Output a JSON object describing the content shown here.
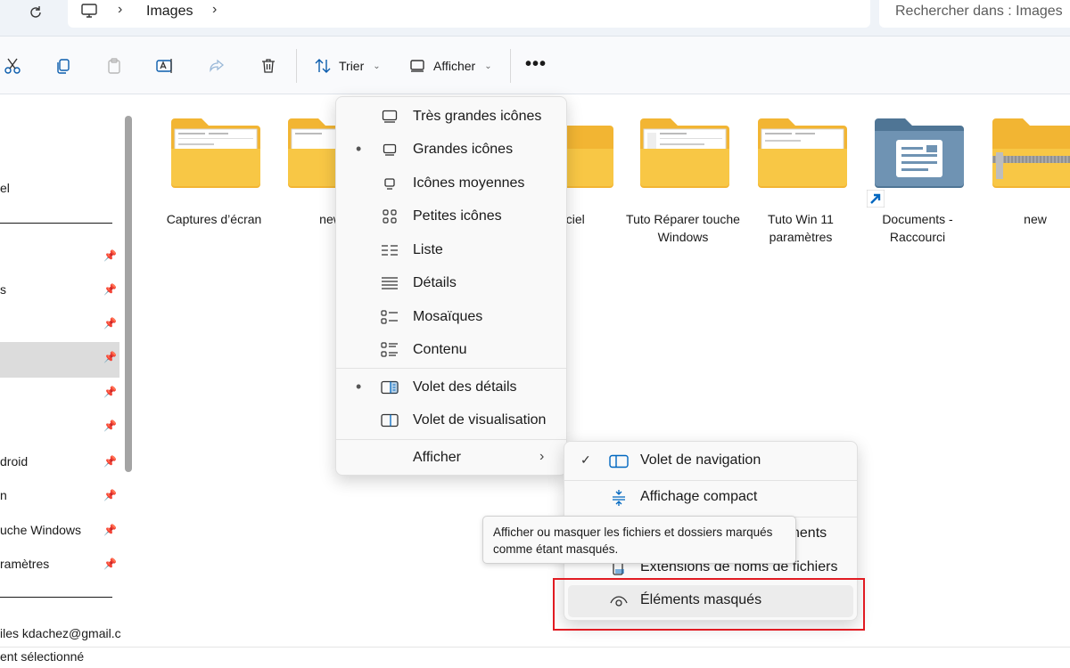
{
  "address_bar": {
    "breadcrumb": [
      "Images"
    ],
    "search_placeholder": "Rechercher dans : Images"
  },
  "command_bar": {
    "buttons": [
      "cut-icon",
      "copy-icon",
      "paste-icon",
      "rename-icon",
      "share-icon",
      "delete-icon"
    ],
    "sort_label": "Trier",
    "view_label": "Afficher",
    "more_label": "•••"
  },
  "sidebar": {
    "items": [
      {
        "label": "el"
      },
      {
        "label": ""
      },
      {
        "label": "s"
      },
      {
        "label": ""
      },
      {
        "label": ""
      },
      {
        "label": ""
      },
      {
        "label": ""
      },
      {
        "label": "droid"
      },
      {
        "label": "n"
      },
      {
        "label": "uche Windows"
      },
      {
        "label": "ramètres"
      }
    ],
    "account": "iles   kdachez@gmail.c"
  },
  "status_bar": {
    "text": "ent sélectionné"
  },
  "folders": [
    {
      "name": "Captures d’écran",
      "type": "folder-preview"
    },
    {
      "name": "new",
      "type": "folder"
    },
    {
      "name": "officiel",
      "type": "folder"
    },
    {
      "name": "Tuto Réparer touche Windows",
      "type": "folder-preview"
    },
    {
      "name": "Tuto Win 11 paramètres",
      "type": "folder-preview"
    },
    {
      "name": "Documents - Raccourci",
      "type": "shortcut"
    },
    {
      "name": "new",
      "type": "zip"
    }
  ],
  "view_menu": {
    "items": [
      {
        "label": "Très grandes icônes",
        "selected": false,
        "icon": "monitor-icon"
      },
      {
        "label": "Grandes icônes",
        "selected": true,
        "icon": "monitor-icon"
      },
      {
        "label": "Icônes moyennes",
        "selected": false,
        "icon": "monitor-small-icon"
      },
      {
        "label": "Petites icônes",
        "selected": false,
        "icon": "grid-icon"
      },
      {
        "label": "Liste",
        "selected": false,
        "icon": "list-icon"
      },
      {
        "label": "Détails",
        "selected": false,
        "icon": "details-icon"
      },
      {
        "label": "Mosaïques",
        "selected": false,
        "icon": "tiles-icon"
      },
      {
        "label": "Contenu",
        "selected": false,
        "icon": "content-icon"
      }
    ],
    "panes": [
      {
        "label": "Volet des détails",
        "selected": true,
        "icon": "details-pane-icon"
      },
      {
        "label": "Volet de visualisation",
        "selected": false,
        "icon": "preview-pane-icon"
      }
    ],
    "show_label": "Afficher"
  },
  "show_submenu": {
    "items": [
      {
        "label": "Volet de navigation",
        "checked": true,
        "icon": "nav-pane-icon"
      },
      {
        "label": "Affichage compact",
        "checked": false,
        "icon": "compact-icon"
      },
      {
        "label": "nents",
        "checked": false,
        "icon": ""
      },
      {
        "label": "Extensions de noms de fichiers",
        "checked": false,
        "icon": "extensions-icon"
      },
      {
        "label": "Éléments masqués",
        "checked": false,
        "icon": "eye-icon"
      }
    ]
  },
  "tooltip": {
    "text": "Afficher ou masquer les fichiers et dossiers marqués comme étant masqués."
  },
  "colors": {
    "folder_yellow": "#f8c745",
    "folder_back": "#f2b533",
    "highlight_red": "#e11b22",
    "accent_blue": "#0067c0"
  }
}
